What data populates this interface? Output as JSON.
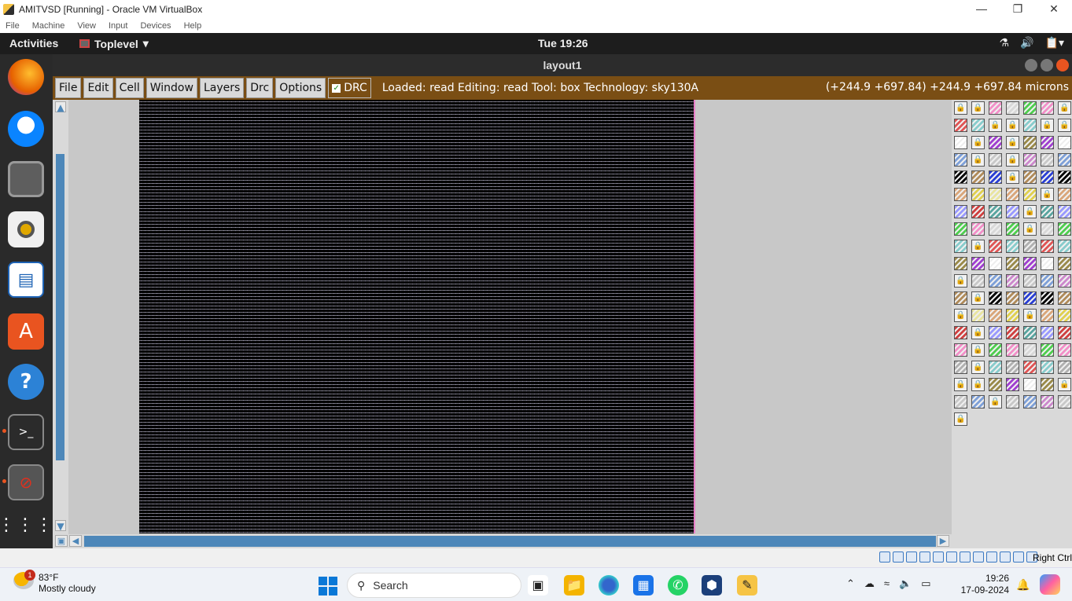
{
  "vbox": {
    "title": "AMITVSD [Running] - Oracle VM VirtualBox",
    "menu": [
      "File",
      "Machine",
      "View",
      "Input",
      "Devices",
      "Help"
    ],
    "status_right": "Right Ctrl"
  },
  "gnome": {
    "activities": "Activities",
    "app_menu": "Toplevel",
    "clock": "Tue 19:26"
  },
  "magic": {
    "window_title": "layout1",
    "menu": [
      "File",
      "Edit",
      "Cell",
      "Window",
      "Layers",
      "Drc",
      "Options"
    ],
    "drc_label": "DRC",
    "status": "Loaded: read Editing: read Tool: box  Technology: sky130A",
    "coords": "(+244.9 +697.84) +244.9 +697.84 microns"
  },
  "dock_icons": [
    "firefox-icon",
    "thunderbird-icon",
    "files-icon",
    "rhythmbox-icon",
    "writer-icon",
    "software-center-icon",
    "help-icon",
    "terminal-icon",
    "magic-icon",
    "apps-grid-icon"
  ],
  "taskbar": {
    "weather_temp": "83°F",
    "weather_desc": "Mostly cloudy",
    "weather_badge": "1",
    "search_placeholder": "Search",
    "time": "19:26",
    "date": "17-09-2024"
  }
}
